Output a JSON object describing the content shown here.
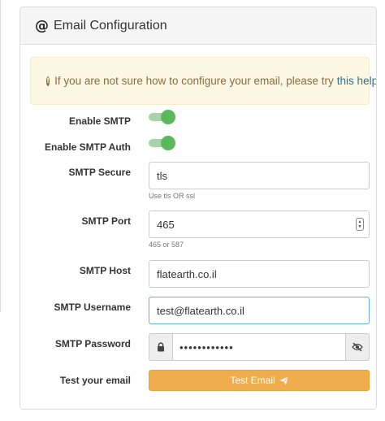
{
  "panel": {
    "title": "Email Configuration",
    "icon": "at-icon"
  },
  "alert": {
    "text": "If you are not sure how to configure your email, please try",
    "link_text": "this help"
  },
  "fields": {
    "enable_smtp": {
      "label": "Enable SMTP",
      "on": true
    },
    "enable_smtp_auth": {
      "label": "Enable SMTP Auth",
      "on": true
    },
    "smtp_secure": {
      "label": "SMTP Secure",
      "value": "tls",
      "help": "Use tls OR ssl"
    },
    "smtp_port": {
      "label": "SMTP Port",
      "value": "465",
      "help": "465 or 587"
    },
    "smtp_host": {
      "label": "SMTP Host",
      "value": "flatearth.co.il"
    },
    "smtp_username": {
      "label": "SMTP Username",
      "value": "test@flatearth.co.il"
    },
    "smtp_password": {
      "label": "SMTP Password",
      "value": "••••••••••••"
    },
    "test_email": {
      "label": "Test your email",
      "button": "Test Email"
    }
  },
  "colors": {
    "toggle_on": "#5cb85c",
    "warning_button": "#f0ad4e",
    "alert_bg": "#fcf8e3",
    "link": "#31708f"
  }
}
